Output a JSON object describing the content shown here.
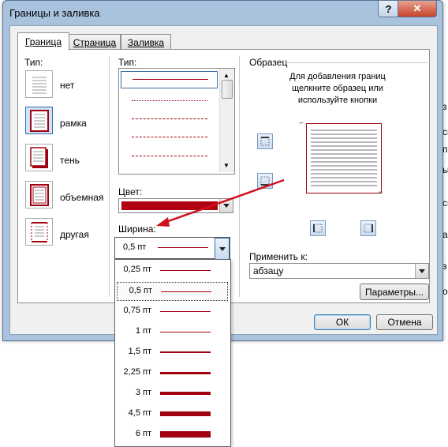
{
  "window": {
    "title": "Границы и заливка"
  },
  "titlebar": {
    "help": "?",
    "close": "✕"
  },
  "tabs": [
    {
      "label": "Граница"
    },
    {
      "label": "Страница"
    },
    {
      "label": "Заливка"
    }
  ],
  "type_section": {
    "label": "Тип:",
    "settings": [
      {
        "label": "нет",
        "icon": "none-border-icon"
      },
      {
        "label": "рамка",
        "icon": "box-border-icon"
      },
      {
        "label": "тень",
        "icon": "shadow-border-icon"
      },
      {
        "label": "объемная",
        "icon": "3d-border-icon"
      },
      {
        "label": "другая",
        "icon": "custom-border-icon"
      }
    ]
  },
  "style_section": {
    "label": "Тип:",
    "color_label": "Цвет:",
    "color_value": "#b00012",
    "width_label": "Ширина:",
    "width_value": "0,5 пт"
  },
  "preview": {
    "label": "Образец",
    "hint": "Для добавления границ щелкните образец или используйте кнопки",
    "apply_label": "Применить к:",
    "apply_value": "абзацу",
    "options_button": "Параметры..."
  },
  "buttons": {
    "ok": "ОК",
    "cancel": "Отмена"
  },
  "width_options": [
    {
      "label": "0,25 пт",
      "pt": 0.25
    },
    {
      "label": "0,5 пт",
      "pt": 0.5,
      "selected": true
    },
    {
      "label": "0,75 пт",
      "pt": 0.75
    },
    {
      "label": "1 пт",
      "pt": 1
    },
    {
      "label": "1,5 пт",
      "pt": 1.5
    },
    {
      "label": "2,25 пт",
      "pt": 2.25
    },
    {
      "label": "3 пт",
      "pt": 3
    },
    {
      "label": "4,5 пт",
      "pt": 4.5
    },
    {
      "label": "6 пт",
      "pt": 6
    }
  ],
  "background_text": [
    "з",
    "сь",
    "п",
    "ы",
    "сь",
    "а",
    "з",
    "о"
  ],
  "colors": {
    "accent": "#b00012",
    "selection": "#cde3f7"
  }
}
